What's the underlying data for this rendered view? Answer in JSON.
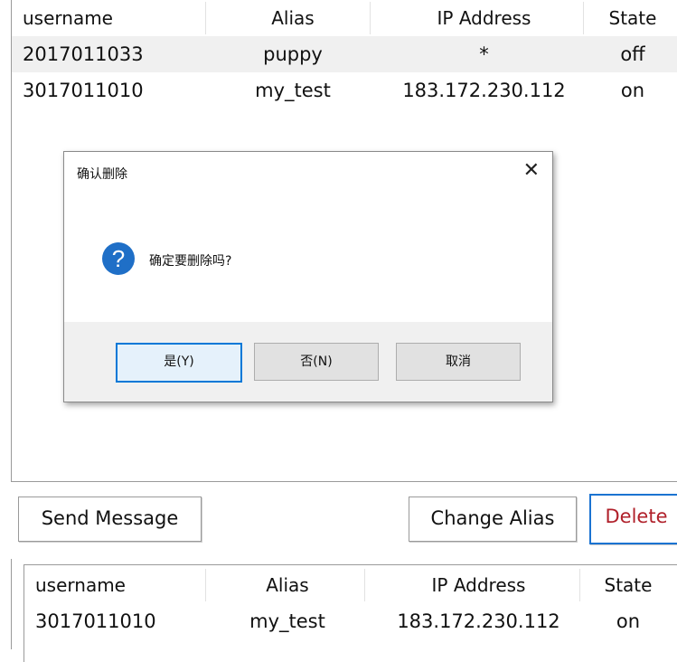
{
  "table_columns": {
    "username": "username",
    "alias": "Alias",
    "ip": "IP Address",
    "state": "State"
  },
  "top_table_rows": [
    {
      "username": "2017011033",
      "alias": "puppy",
      "ip": "*",
      "state": "off"
    },
    {
      "username": "3017011010",
      "alias": "my_test",
      "ip": "183.172.230.112",
      "state": "on"
    }
  ],
  "dialog": {
    "title": "确认删除",
    "message": "确定要删除吗?",
    "close_glyph": "✕",
    "question_glyph": "?",
    "buttons": {
      "yes": "是(Y)",
      "no": "否(N)",
      "cancel": "取消"
    }
  },
  "actions": {
    "send_message": "Send Message",
    "change_alias": "Change Alias",
    "delete": "Delete"
  },
  "bottom_table_rows": [
    {
      "username": "3017011010",
      "alias": "my_test",
      "ip": "183.172.230.112",
      "state": "on"
    }
  ],
  "colors": {
    "delete_text": "#b0202a",
    "delete_border": "#1b73d1",
    "question_icon": "#1f6fc7",
    "selected_row": "#f0f0f0"
  }
}
